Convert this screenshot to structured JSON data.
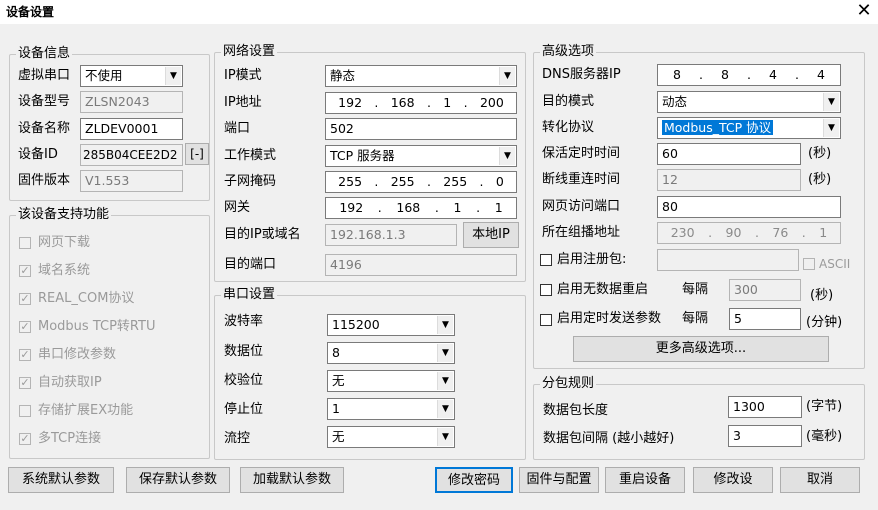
{
  "window": {
    "title": "设备设置",
    "close": "✕"
  },
  "device_info": {
    "group": "设备信息",
    "virtual_port_label": "虚拟串口",
    "virtual_port_value": "不使用",
    "model_label": "设备型号",
    "model_value": "ZLSN2043",
    "name_label": "设备名称",
    "name_value": "ZLDEV0001",
    "id_label": "设备ID",
    "id_value": "285B04CEE2D2",
    "id_button": "[-]",
    "firmware_label": "固件版本",
    "firmware_value": "V1.553"
  },
  "features": {
    "group": "该设备支持功能",
    "items": [
      {
        "label": "网页下载",
        "checked": false
      },
      {
        "label": "域名系统",
        "checked": true
      },
      {
        "label": "REAL_COM协议",
        "checked": true
      },
      {
        "label": "Modbus TCP转RTU",
        "checked": true
      },
      {
        "label": "串口修改参数",
        "checked": true
      },
      {
        "label": "自动获取IP",
        "checked": true
      },
      {
        "label": "存储扩展EX功能",
        "checked": false
      },
      {
        "label": "多TCP连接",
        "checked": true
      }
    ]
  },
  "network": {
    "group": "网络设置",
    "ip_mode_label": "IP模式",
    "ip_mode_value": "静态",
    "ip_label": "IP地址",
    "ip_parts": [
      "192",
      "168",
      "1",
      "200"
    ],
    "port_label": "端口",
    "port_value": "502",
    "work_mode_label": "工作模式",
    "work_mode_value": "TCP 服务器",
    "mask_label": "子网掩码",
    "mask_parts": [
      "255",
      "255",
      "255",
      "0"
    ],
    "gateway_label": "网关",
    "gateway_parts": [
      "192",
      "168",
      "1",
      "1"
    ],
    "dest_ip_label": "目的IP或域名",
    "dest_ip_value": "192.168.1.3",
    "local_ip_button": "本地IP",
    "dest_port_label": "目的端口",
    "dest_port_value": "4196"
  },
  "serial": {
    "group": "串口设置",
    "baud_label": "波特率",
    "baud_value": "115200",
    "databits_label": "数据位",
    "databits_value": "8",
    "parity_label": "校验位",
    "parity_value": "无",
    "stopbits_label": "停止位",
    "stopbits_value": "1",
    "flow_label": "流控",
    "flow_value": "无"
  },
  "advanced": {
    "group": "高级选项",
    "dns_label": "DNS服务器IP",
    "dns_parts": [
      "8",
      "8",
      "4",
      "4"
    ],
    "dest_mode_label": "目的模式",
    "dest_mode_value": "动态",
    "protocol_label": "转化协议",
    "protocol_value": "Modbus_TCP 协议",
    "keepalive_label": "保活定时时间",
    "keepalive_value": "60",
    "keepalive_unit": "(秒)",
    "reconnect_label": "断线重连时间",
    "reconnect_value": "12",
    "reconnect_unit": "(秒)",
    "web_port_label": "网页访问端口",
    "web_port_value": "80",
    "multicast_label": "所在组播地址",
    "multicast_parts": [
      "230",
      "90",
      "76",
      "1"
    ],
    "register_label": "启用注册包:",
    "ascii_label": "ASCII",
    "nodata_restart_label": "启用无数据重启",
    "nodata_every": "每隔",
    "nodata_value": "300",
    "nodata_unit": "(秒)",
    "timed_send_label": "启用定时发送参数",
    "timed_every": "每隔",
    "timed_value": "5",
    "timed_unit": "(分钟)",
    "more_button": "更多高级选项..."
  },
  "packet": {
    "group": "分包规则",
    "length_label": "数据包长度",
    "length_value": "1300",
    "length_unit": "(字节)",
    "interval_label": "数据包间隔 (越小越好)",
    "interval_value": "3",
    "interval_unit": "(毫秒)"
  },
  "buttons": {
    "sys_default": "系统默认参数",
    "save_default": "保存默认参数",
    "load_default": "加载默认参数",
    "change_password": "修改密码",
    "firmware_config": "固件与配置",
    "restart": "重启设备",
    "modify": "修改设",
    "cancel": "取消"
  }
}
